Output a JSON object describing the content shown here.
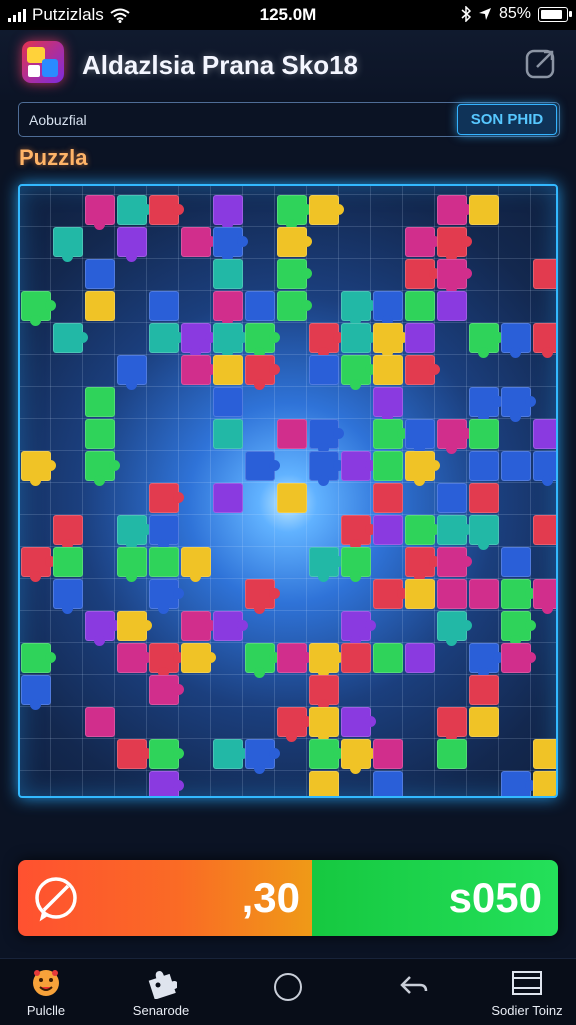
{
  "status_bar": {
    "carrier": "Putzizlals",
    "time": "125.0M",
    "battery": "85%"
  },
  "header": {
    "app_title": "Aldazlsia Prana Sko18"
  },
  "search": {
    "value": "Aobuzfial",
    "placeholder": "",
    "button_label": "SON PHID"
  },
  "section_title": "Puzzla",
  "score": {
    "left_value": ",30",
    "right_value": "s050"
  },
  "nav": {
    "items": [
      "Pulclle",
      "Senarode",
      "",
      "",
      "Sodier Toinz"
    ]
  },
  "colors": {
    "accent": "#33b9ff",
    "title_orange": "#ffb468",
    "score_orange": "#fa6b25",
    "score_green": "#24e05a",
    "pieces": [
      "#2fd35a",
      "#d12e8c",
      "#2a5fd8",
      "#f0c326",
      "#8a3ae0",
      "#e23b4f",
      "#22b8a6"
    ]
  },
  "icons": [
    "wifi-icon",
    "bluetooth-icon",
    "location-icon",
    "battery-icon",
    "app-logo-icon",
    "share-icon",
    "cancel-icon",
    "face-icon",
    "puzzle-piece-icon",
    "home-circle-icon",
    "back-arrow-icon",
    "window-icon"
  ]
}
